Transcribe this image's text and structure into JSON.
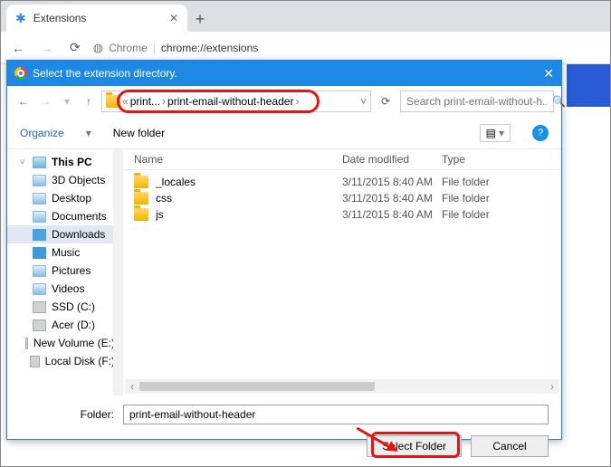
{
  "browser": {
    "tab_title": "Extensions",
    "url_label": "Chrome",
    "url_path": "chrome://extensions"
  },
  "dialog": {
    "title": "Select the extension directory.",
    "breadcrumbs": [
      "print...",
      "print-email-without-header"
    ],
    "search_placeholder": "Search print-email-without-h...",
    "organize": "Organize",
    "new_folder": "New folder",
    "columns": {
      "name": "Name",
      "date": "Date modified",
      "type": "Type"
    },
    "rows": [
      {
        "name": "_locales",
        "date": "3/11/2015 8:40 AM",
        "type": "File folder"
      },
      {
        "name": "css",
        "date": "3/11/2015 8:40 AM",
        "type": "File folder"
      },
      {
        "name": "js",
        "date": "3/11/2015 8:40 AM",
        "type": "File folder"
      }
    ],
    "sidebar": [
      {
        "label": "This PC",
        "icon": "ico-pc",
        "bold": true
      },
      {
        "label": "3D Objects",
        "icon": "ico-gen"
      },
      {
        "label": "Desktop",
        "icon": "ico-gen"
      },
      {
        "label": "Documents",
        "icon": "ico-gen"
      },
      {
        "label": "Downloads",
        "icon": "ico-dl",
        "selected": true
      },
      {
        "label": "Music",
        "icon": "ico-mus"
      },
      {
        "label": "Pictures",
        "icon": "ico-gen"
      },
      {
        "label": "Videos",
        "icon": "ico-gen"
      },
      {
        "label": "SSD (C:)",
        "icon": "ico-disk"
      },
      {
        "label": "Acer (D:)",
        "icon": "ico-disk"
      },
      {
        "label": "New Volume (E:)",
        "icon": "ico-disk"
      },
      {
        "label": "Local Disk (F:)",
        "icon": "ico-disk"
      }
    ],
    "folder_label": "Folder:",
    "folder_value": "print-email-without-header",
    "select_btn": "Select Folder",
    "cancel_btn": "Cancel"
  }
}
